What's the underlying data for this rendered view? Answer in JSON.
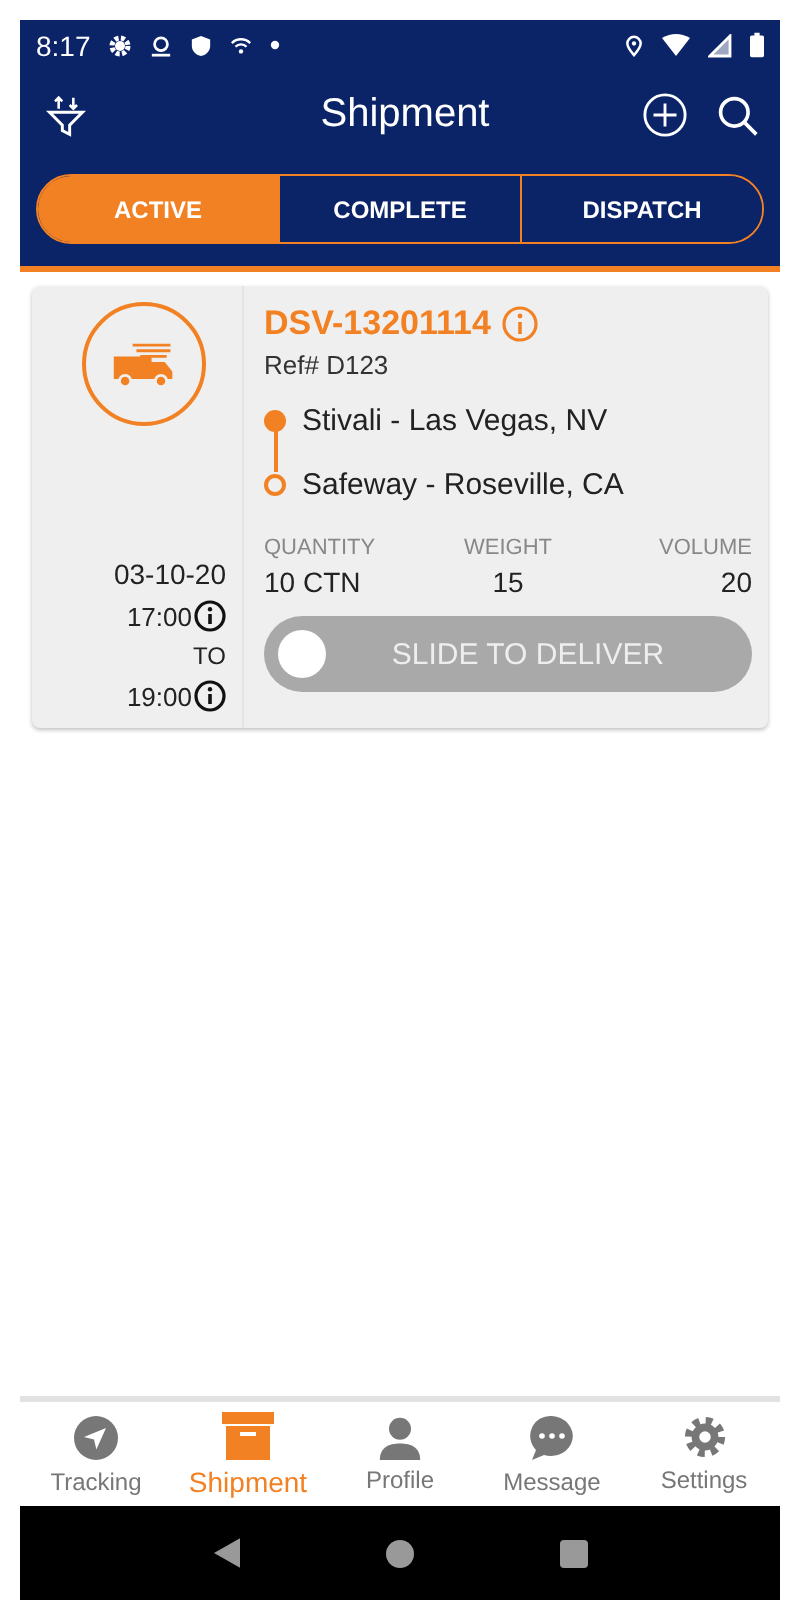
{
  "status_bar": {
    "time": "8:17"
  },
  "app_bar": {
    "title": "Shipment"
  },
  "tabs": [
    {
      "label": "ACTIVE",
      "selected": true
    },
    {
      "label": "COMPLETE",
      "selected": false
    },
    {
      "label": "DISPATCH",
      "selected": false
    }
  ],
  "shipments": [
    {
      "id": "DSV-13201114",
      "ref": "Ref# D123",
      "date": "03-10-20",
      "time_from": "17:00",
      "to_label": "TO",
      "time_to": "19:00",
      "stops": [
        {
          "name": "Stivali - Las Vegas, NV",
          "kind": "origin"
        },
        {
          "name": "Safeway - Roseville, CA",
          "kind": "destination"
        }
      ],
      "metrics": [
        {
          "label": "QUANTITY",
          "value": "10 CTN"
        },
        {
          "label": "WEIGHT",
          "value": "15"
        },
        {
          "label": "VOLUME",
          "value": "20"
        }
      ],
      "slider": {
        "label": "SLIDE TO DELIVER",
        "level": 0
      }
    }
  ],
  "bottom_nav": [
    {
      "label": "Tracking",
      "selected": false
    },
    {
      "label": "Shipment",
      "selected": true
    },
    {
      "label": "Profile",
      "selected": false
    },
    {
      "label": "Message",
      "selected": false
    },
    {
      "label": "Settings",
      "selected": false
    }
  ]
}
